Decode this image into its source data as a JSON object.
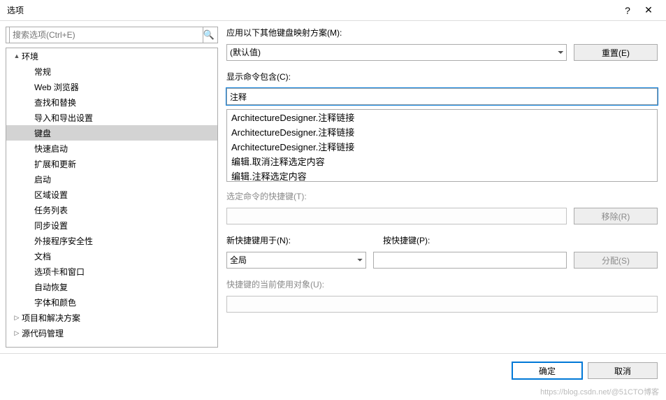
{
  "titlebar": {
    "title": "选项",
    "help": "?",
    "close": "✕"
  },
  "search": {
    "placeholder": "搜索选项(Ctrl+E)"
  },
  "tree": {
    "env_label": "环境",
    "items": [
      "常规",
      "Web 浏览器",
      "查找和替换",
      "导入和导出设置",
      "键盘",
      "快速启动",
      "扩展和更新",
      "启动",
      "区域设置",
      "任务列表",
      "同步设置",
      "外接程序安全性",
      "文档",
      "选项卡和窗口",
      "自动恢复",
      "字体和颜色"
    ],
    "proj_label": "项目和解决方案",
    "src_label": "源代码管理"
  },
  "panel": {
    "scheme_label": "应用以下其他键盘映射方案(M):",
    "scheme_value": "(默认值)",
    "reset_btn": "重置(E)",
    "show_label": "显示命令包含(C):",
    "show_value": "注释",
    "commands": [
      "ArchitectureDesigner.注释链接",
      "ArchitectureDesigner.注释链接",
      "ArchitectureDesigner.注释链接",
      "编辑.取消注释选定内容",
      "编辑.注释选定内容"
    ],
    "shortcut_label": "选定命令的快捷键(T):",
    "remove_btn": "移除(R)",
    "newkey_label": "新快捷键用于(N):",
    "newkey_scope": "全局",
    "press_label": "按快捷键(P):",
    "assign_btn": "分配(S)",
    "used_label": "快捷键的当前使用对象(U):"
  },
  "footer": {
    "ok": "确定",
    "cancel": "取消"
  },
  "watermark": "https://blog.csdn.net/@51CTO博客"
}
